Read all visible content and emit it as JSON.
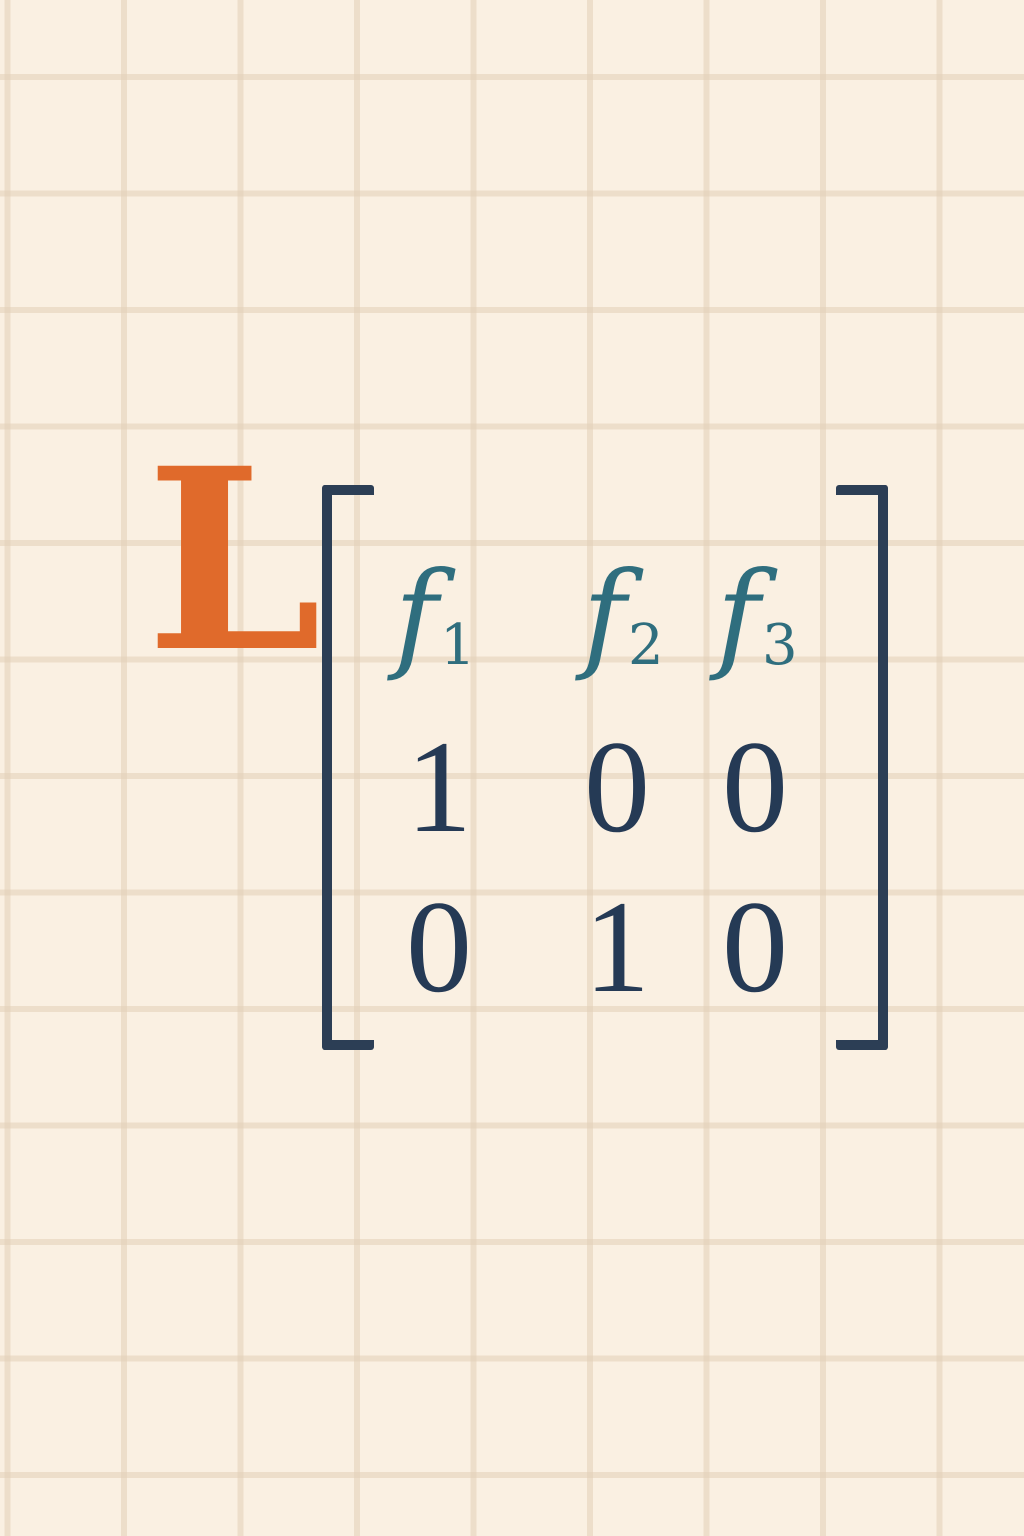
{
  "operator": "L",
  "matrix": {
    "headers": [
      {
        "symbol": "f",
        "index": "1"
      },
      {
        "symbol": "f",
        "index": "2"
      },
      {
        "symbol": "f",
        "index": "3"
      }
    ],
    "rows": [
      [
        "1",
        "0",
        "0"
      ],
      [
        "0",
        "1",
        "0"
      ]
    ]
  },
  "colors": {
    "background": "#faf0e2",
    "grid": "#e2cfb7",
    "operator": "#e06a2b",
    "headers": "#2f6e7e",
    "entries": "#253a55",
    "brackets": "#2c3e55"
  }
}
